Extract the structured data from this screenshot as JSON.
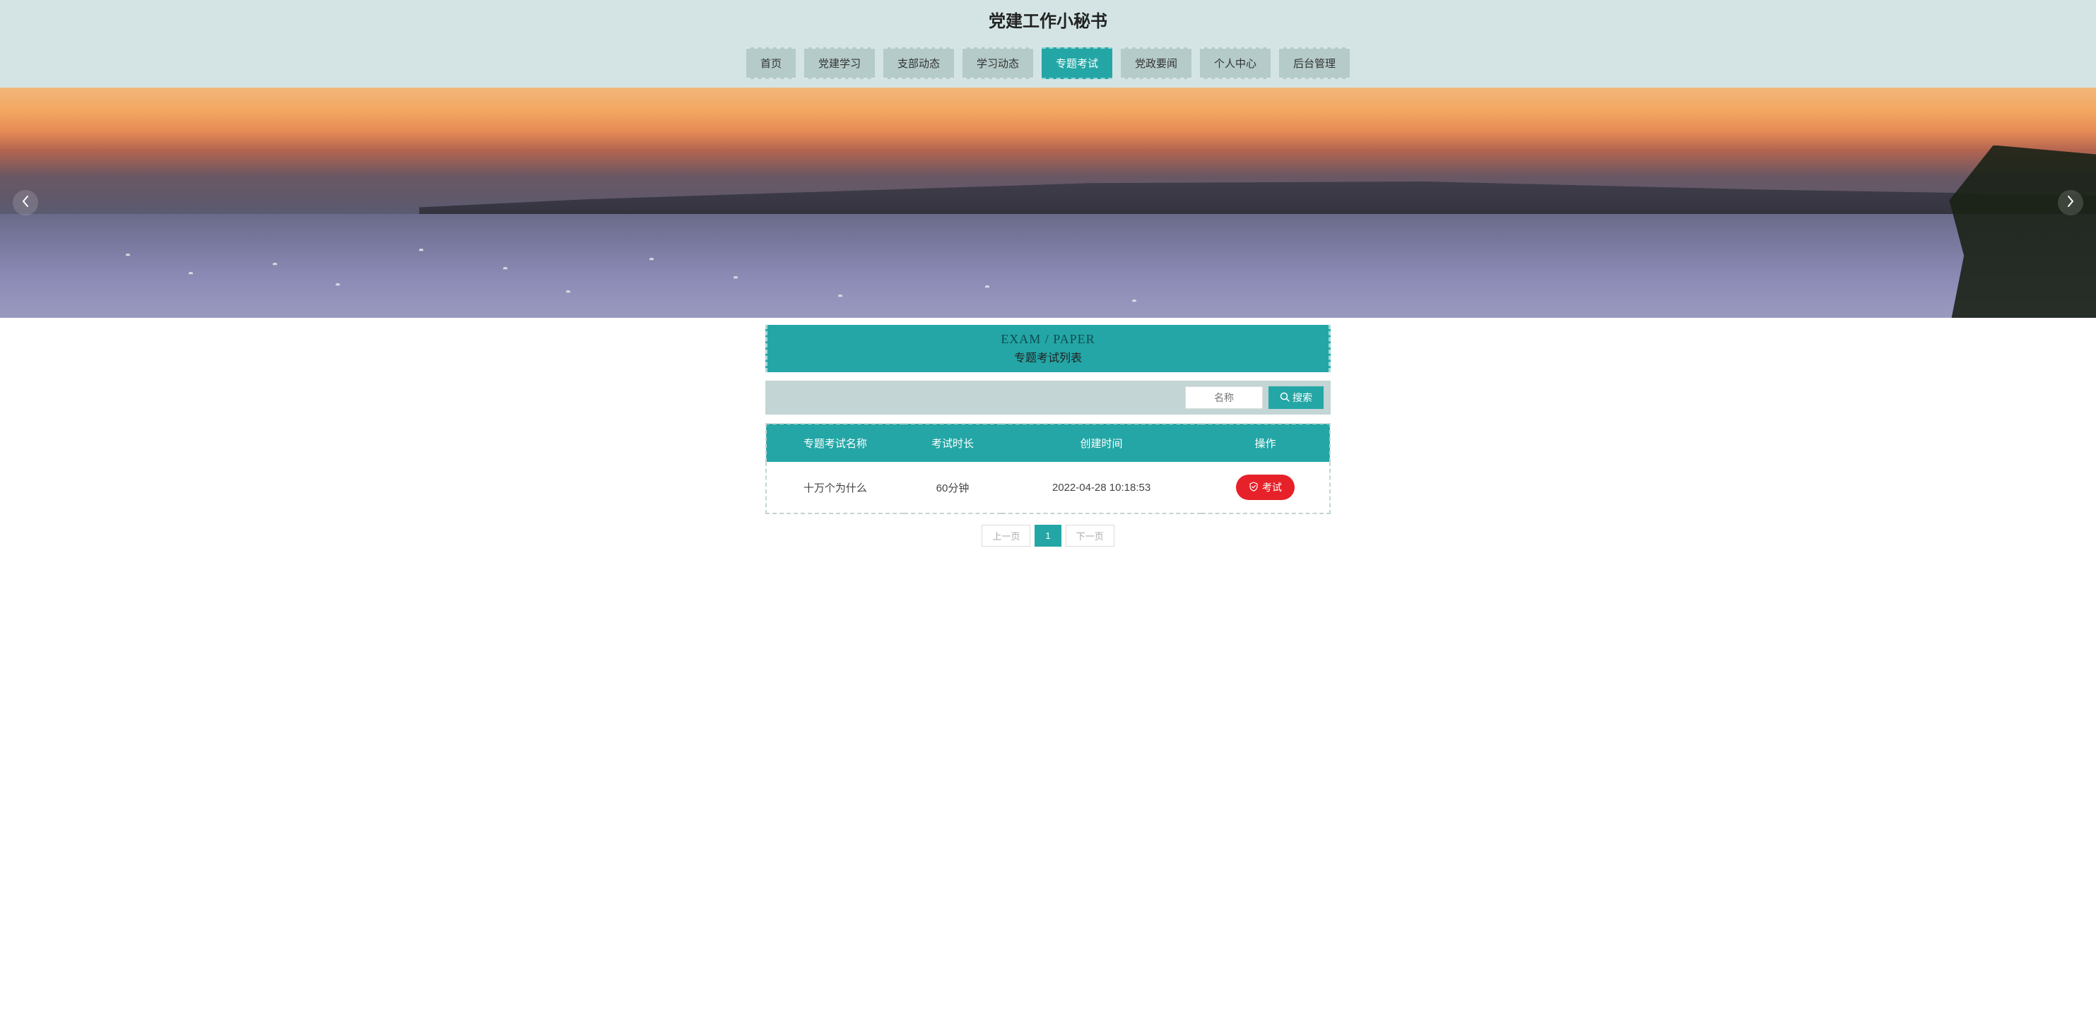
{
  "header": {
    "title": "党建工作小秘书"
  },
  "nav": {
    "items": [
      {
        "label": "首页"
      },
      {
        "label": "党建学习"
      },
      {
        "label": "支部动态"
      },
      {
        "label": "学习动态"
      },
      {
        "label": "专题考试",
        "active": true
      },
      {
        "label": "党政要闻"
      },
      {
        "label": "个人中心"
      },
      {
        "label": "后台管理"
      }
    ]
  },
  "section": {
    "title_en": "EXAM / PAPER",
    "title_cn": "专题考试列表"
  },
  "search": {
    "placeholder": "名称",
    "button": "搜索"
  },
  "table": {
    "headers": [
      "专题考试名称",
      "考试时长",
      "创建时间",
      "操作"
    ],
    "rows": [
      {
        "name": "十万个为什么",
        "duration": "60分钟",
        "created": "2022-04-28 10:18:53",
        "action": "考试"
      }
    ]
  },
  "pagination": {
    "prev": "上一页",
    "current": "1",
    "next": "下一页"
  },
  "colors": {
    "primary": "#24a6a6",
    "danger": "#e62129",
    "muted_bg": "#d4e4e4"
  }
}
